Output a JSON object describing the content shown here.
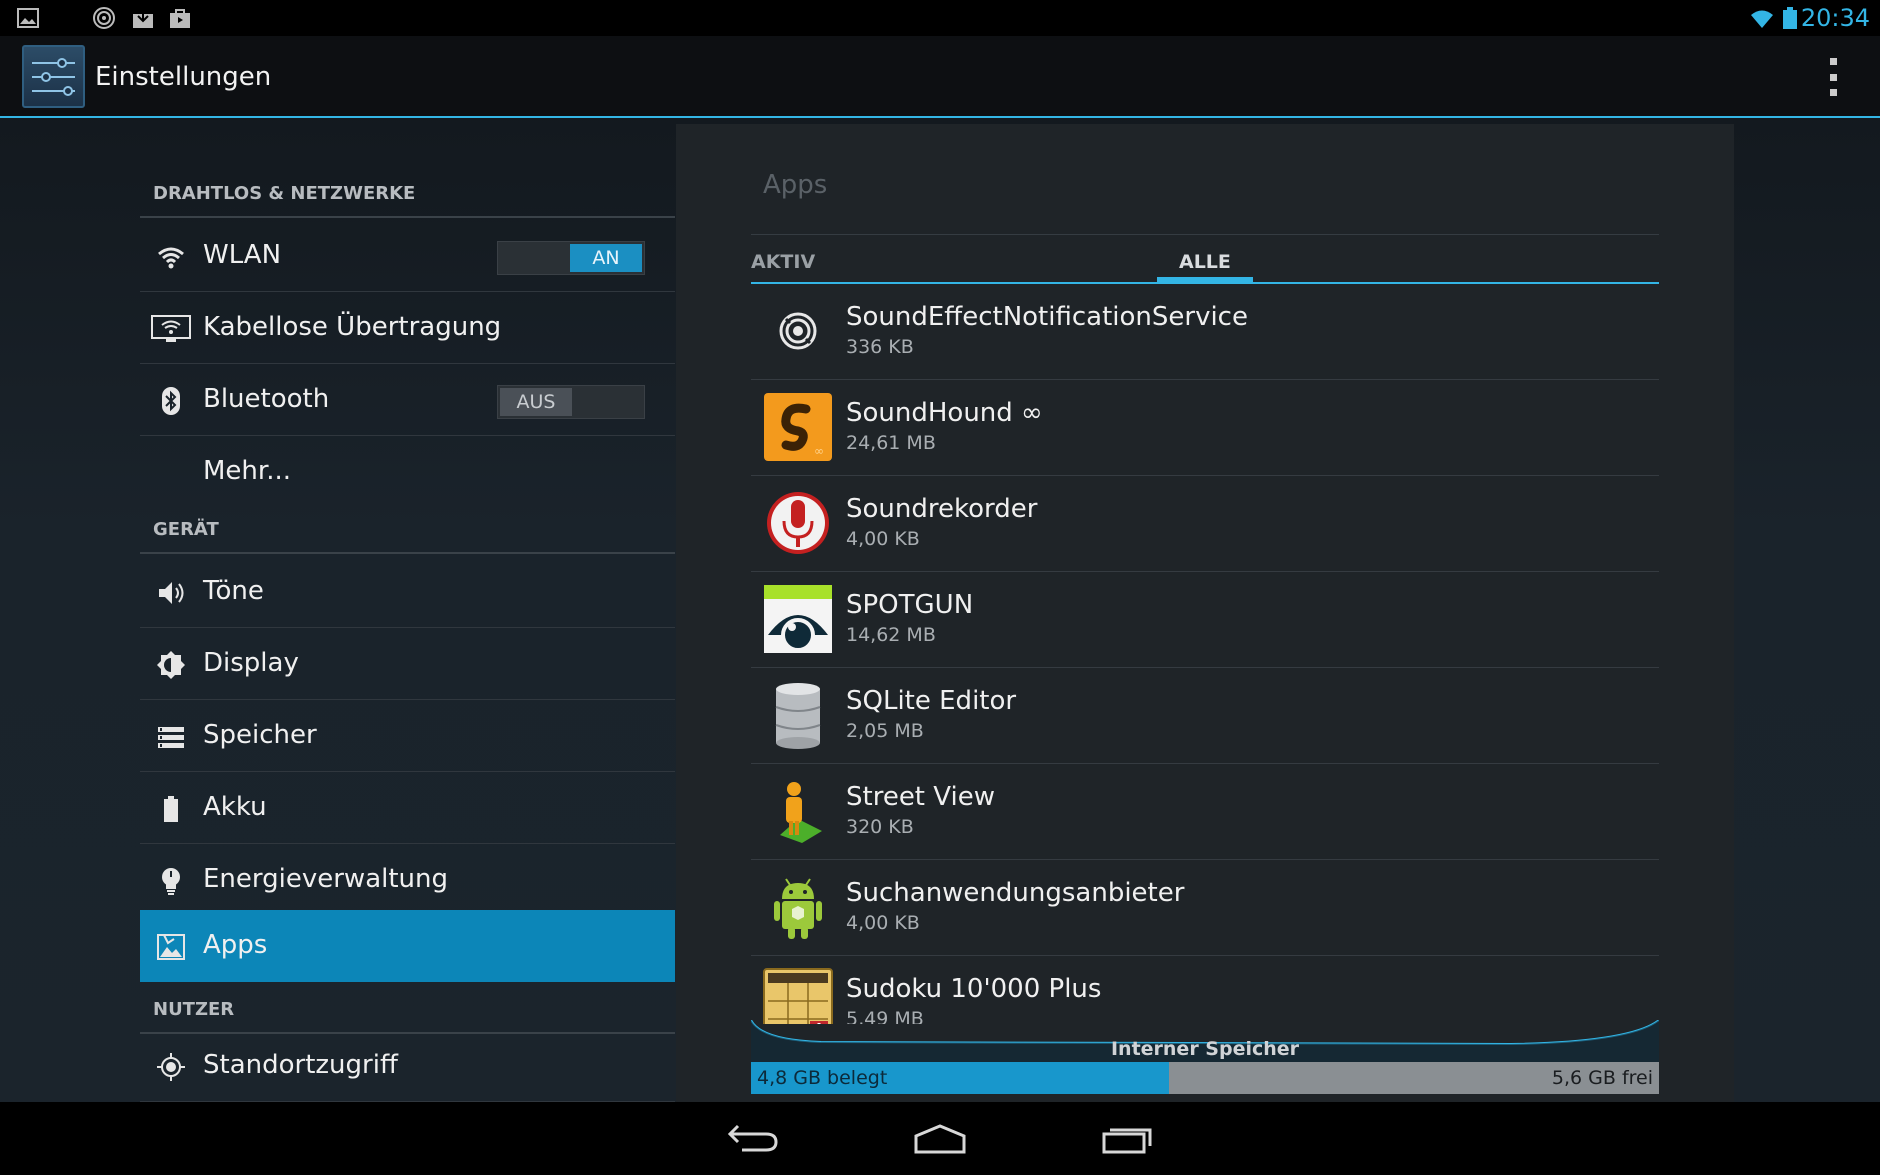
{
  "status_bar": {
    "time": "20:34",
    "icons": [
      "picture-icon",
      "sound-effect-icon",
      "download-icon",
      "store-icon",
      "wifi-icon",
      "battery-icon"
    ]
  },
  "action_bar": {
    "title": "Einstellungen",
    "icon": "settings-sliders-icon"
  },
  "nav": {
    "sections": [
      {
        "header": "DRAHTLOS & NETZWERKE",
        "items": [
          {
            "label": "WLAN",
            "icon": "wifi-icon",
            "switch": "AN"
          },
          {
            "label": "Kabellose Übertragung",
            "icon": "wireless-display-icon"
          },
          {
            "label": "Bluetooth",
            "icon": "bluetooth-icon",
            "switch": "AUS"
          },
          {
            "label": "Mehr...",
            "icon": ""
          }
        ]
      },
      {
        "header": "GERÄT",
        "items": [
          {
            "label": "Töne",
            "icon": "volume-icon"
          },
          {
            "label": "Display",
            "icon": "brightness-icon"
          },
          {
            "label": "Speicher",
            "icon": "storage-icon"
          },
          {
            "label": "Akku",
            "icon": "battery-icon"
          },
          {
            "label": "Energieverwaltung",
            "icon": "lightbulb-icon"
          },
          {
            "label": "Apps",
            "icon": "apps-icon",
            "active": true
          }
        ]
      },
      {
        "header": "NUTZER",
        "items": [
          {
            "label": "Standortzugriff",
            "icon": "location-icon"
          }
        ]
      }
    ]
  },
  "panel": {
    "title": "Apps",
    "tabs": [
      "AKTIV",
      "ALLE"
    ],
    "selected_tab": "ALLE",
    "apps": [
      {
        "name": "SoundEffectNotificationService",
        "size": "336 KB",
        "icon": "sound-effect-icon"
      },
      {
        "name": "SoundHound ∞",
        "size": "24,61 MB",
        "icon": "soundhound-icon"
      },
      {
        "name": "Soundrekorder",
        "size": "4,00 KB",
        "icon": "microphone-icon"
      },
      {
        "name": "SPOTGUN",
        "size": "14,62 MB",
        "icon": "spotgun-eye-icon"
      },
      {
        "name": "SQLite Editor",
        "size": "2,05 MB",
        "icon": "database-icon"
      },
      {
        "name": "Street View",
        "size": "320 KB",
        "icon": "pegman-icon"
      },
      {
        "name": "Suchanwendungsanbieter",
        "size": "4,00 KB",
        "icon": "android-icon"
      },
      {
        "name": "Sudoku 10'000 Plus",
        "size": "5,49 MB",
        "icon": "sudoku-icon"
      }
    ],
    "storage": {
      "label": "Interner Speicher",
      "used": "4,8 GB belegt",
      "free": "5,6 GB frei",
      "used_fraction": 0.46
    }
  },
  "navbar": {
    "buttons": [
      "back-icon",
      "home-icon",
      "recents-icon"
    ]
  },
  "colors": {
    "accent": "#33b5e5",
    "active_item": "#0c86b8",
    "panel_bg": "#1f2428"
  }
}
